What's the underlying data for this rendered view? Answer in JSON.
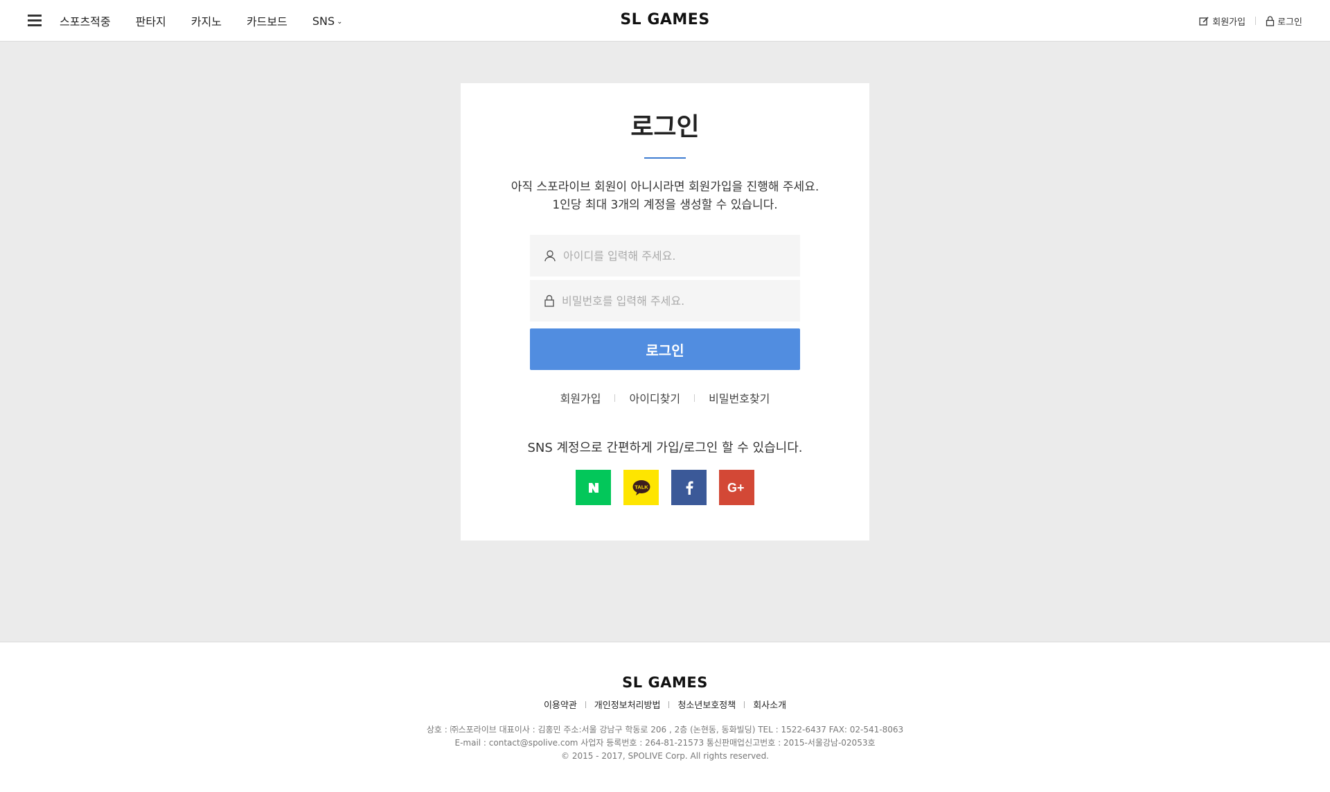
{
  "header": {
    "logo": "SL GAMES",
    "nav": [
      {
        "label": "스포츠적중"
      },
      {
        "label": "판타지"
      },
      {
        "label": "카지노"
      },
      {
        "label": "카드보드"
      },
      {
        "label": "SNS"
      }
    ],
    "util": {
      "signup": "회원가입",
      "login": "로그인"
    }
  },
  "login": {
    "title": "로그인",
    "desc_line1": "아직 스포라이브 회원이 아니시라면 회원가입을 진행해 주세요.",
    "desc_line2": "1인당 최대 3개의 계정을 생성할 수 있습니다.",
    "id_placeholder": "아이디를 입력해 주세요.",
    "pw_placeholder": "비밀번호를 입력해 주세요.",
    "button": "로그인",
    "links": {
      "signup": "회원가입",
      "find_id": "아이디찾기",
      "find_pw": "비밀번호찾기"
    },
    "sns_text": "SNS 계정으로 간편하게 가입/로그인 할 수 있습니다.",
    "sns": [
      {
        "name": "naver",
        "color": "#03c75a"
      },
      {
        "name": "kakao",
        "color": "#fee500"
      },
      {
        "name": "facebook",
        "color": "#3b5998"
      },
      {
        "name": "google-plus",
        "color": "#d34836"
      }
    ]
  },
  "footer": {
    "logo": "SL GAMES",
    "links": {
      "terms": "이용약관",
      "privacy": "개인정보처리방법",
      "youth": "청소년보호정책",
      "about": "회사소개"
    },
    "info_line1": "상호 : ㈜스포라이브 대표이사 : 김홍민  주소:서울 강남구 학동로 206 , 2층 (논현동, 동화빌딩)  TEL : 1522-6437 FAX: 02-541-8063",
    "info_line2": "E-mail : contact@spolive.com 사업자 등록번호 : 264-81-21573 통신판매업신고번호 : 2015-서울강남-02053호",
    "copyright": "© 2015 - 2017, SPOLIVE Corp. All rights reserved."
  },
  "colors": {
    "accent": "#518de0",
    "title_bar": "#3d7bd1",
    "page_bg": "#ebebeb"
  }
}
